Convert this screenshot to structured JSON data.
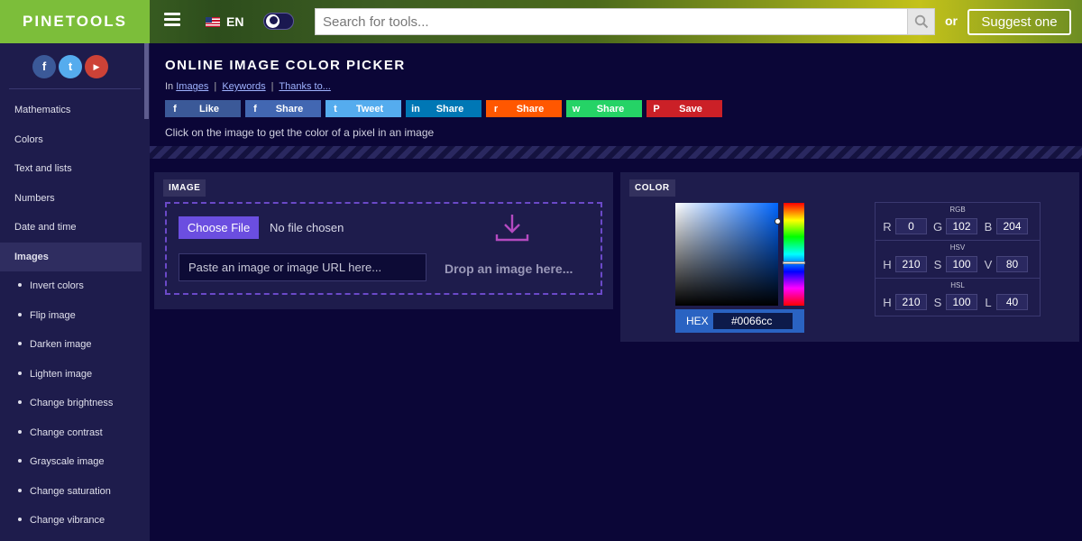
{
  "header": {
    "logo": "PINETOOLS",
    "lang": "EN",
    "search_placeholder": "Search for tools...",
    "or": "or",
    "suggest": "Suggest one"
  },
  "sidebar": {
    "social": [
      "f",
      "t",
      "▶"
    ],
    "items": [
      {
        "label": "Mathematics"
      },
      {
        "label": "Colors"
      },
      {
        "label": "Text and lists"
      },
      {
        "label": "Numbers"
      },
      {
        "label": "Date and time"
      },
      {
        "label": "Images"
      },
      {
        "label": "Invert colors"
      },
      {
        "label": "Flip image"
      },
      {
        "label": "Darken image"
      },
      {
        "label": "Lighten image"
      },
      {
        "label": "Change brightness"
      },
      {
        "label": "Change contrast"
      },
      {
        "label": "Grayscale image"
      },
      {
        "label": "Change saturation"
      },
      {
        "label": "Change vibrance"
      }
    ]
  },
  "page": {
    "title": "ONLINE IMAGE COLOR PICKER",
    "crumb_in": "In",
    "crumbs": [
      "Images",
      "Keywords",
      "Thanks to..."
    ],
    "crumb_sep": "|",
    "instructions": "Click on the image to get the color of a pixel in an image"
  },
  "share": [
    {
      "label": "Like",
      "icon": "f",
      "color": "#3b5998"
    },
    {
      "label": "Share",
      "icon": "f",
      "color": "#4267b2"
    },
    {
      "label": "Tweet",
      "icon": "t",
      "color": "#55acee"
    },
    {
      "label": "Share",
      "icon": "in",
      "color": "#0077b5"
    },
    {
      "label": "Share",
      "icon": "r",
      "color": "#ff5700"
    },
    {
      "label": "Share",
      "icon": "w",
      "color": "#25d366"
    },
    {
      "label": "Save",
      "icon": "P",
      "color": "#cb2027"
    }
  ],
  "image_panel": {
    "tag": "IMAGE",
    "choose_file": "Choose File",
    "no_file": "No file chosen",
    "url_placeholder": "Paste an image or image URL here...",
    "drop_text": "Drop an image here..."
  },
  "color_panel": {
    "tag": "COLOR",
    "hex_label": "HEX",
    "hex_value": "#0066cc",
    "groups": [
      {
        "name": "RGB",
        "keys": [
          "R",
          "G",
          "B"
        ],
        "values": [
          "0",
          "102",
          "204"
        ]
      },
      {
        "name": "HSV",
        "keys": [
          "H",
          "S",
          "V"
        ],
        "values": [
          "210",
          "100",
          "80"
        ]
      },
      {
        "name": "HSL",
        "keys": [
          "H",
          "S",
          "L"
        ],
        "values": [
          "210",
          "100",
          "40"
        ]
      }
    ]
  }
}
